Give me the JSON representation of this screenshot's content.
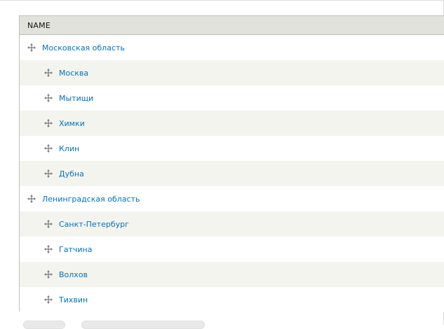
{
  "table": {
    "header": "NAME",
    "rows": [
      {
        "label": "Московская область",
        "level": 0
      },
      {
        "label": "Москва",
        "level": 1
      },
      {
        "label": "Мытищи",
        "level": 1
      },
      {
        "label": "Химки",
        "level": 1
      },
      {
        "label": "Клин",
        "level": 1
      },
      {
        "label": "Дубна",
        "level": 1
      },
      {
        "label": "Ленинградская область",
        "level": 0
      },
      {
        "label": "Санкт-Петербург",
        "level": 1
      },
      {
        "label": "Гатчина",
        "level": 1
      },
      {
        "label": "Волхов",
        "level": 1
      },
      {
        "label": "Тихвин",
        "level": 1
      }
    ]
  },
  "icons": {
    "drag_handle": "move-arrows-icon"
  },
  "colors": {
    "link": "#0074bd",
    "header_bg": "#e1e2dc",
    "stripe": "#f3f4ee"
  }
}
